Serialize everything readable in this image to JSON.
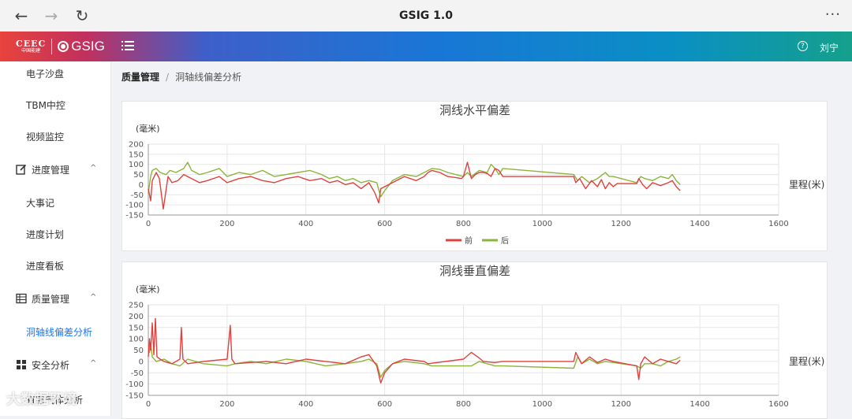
{
  "browser": {
    "back_glyph": "←",
    "forward_glyph": "→",
    "reload_glyph": "↻",
    "title": "GSIG 1.0",
    "more_glyph": "···"
  },
  "app": {
    "logo_top": "CEEC",
    "logo_bottom": "中国能建",
    "logo_text": "GSIG",
    "help_glyph": "?",
    "user": "刘宁",
    "accent": "#1677ff"
  },
  "sidebar": {
    "items": [
      {
        "label": "电子沙盘"
      },
      {
        "label": "TBM中控"
      },
      {
        "label": "视频监控"
      },
      {
        "label": "进度管理",
        "icon": "edit-icon",
        "chevron": "^"
      },
      {
        "label": "大事记"
      },
      {
        "label": "进度计划"
      },
      {
        "label": "进度看板"
      },
      {
        "label": "质量管理",
        "icon": "table-icon",
        "chevron": "^"
      },
      {
        "label": "洞轴线偏差分析"
      },
      {
        "label": "安全分析",
        "icon": "grid-icon",
        "chevron": "^"
      },
      {
        "label": "有害气体分析"
      }
    ]
  },
  "breadcrumb": {
    "first": "质量管理",
    "separator": "/",
    "second": "洞轴线偏差分析"
  },
  "watermark": "大数据环境",
  "chart_data": [
    {
      "type": "line",
      "title": "洞线水平偏差",
      "ylabel": "(毫米)",
      "xlabel": "里程(米)",
      "xlim": [
        0,
        1600
      ],
      "ylim": [
        -150,
        200
      ],
      "xticks": [
        "0",
        "200",
        "400",
        "600",
        "800",
        "1000",
        "1200",
        "1400",
        "1600"
      ],
      "yticks": [
        "200",
        "150",
        "100",
        "50",
        "0",
        "-50",
        "-100",
        "-150"
      ],
      "grid": true,
      "legend": "bottom",
      "series": [
        {
          "name": "前",
          "color": "#e0413e",
          "x": [
            0,
            6,
            10,
            20,
            28,
            38,
            50,
            60,
            75,
            90,
            110,
            130,
            150,
            180,
            200,
            230,
            260,
            290,
            320,
            350,
            380,
            410,
            440,
            460,
            480,
            500,
            520,
            540,
            560,
            575,
            585,
            590,
            600,
            620,
            650,
            680,
            700,
            710,
            720,
            740,
            760,
            780,
            795,
            800,
            810,
            820,
            830,
            840,
            850,
            860,
            870,
            880,
            890,
            900,
            1080,
            1085,
            1095,
            1110,
            1125,
            1140,
            1150,
            1160,
            1170,
            1180,
            1190,
            1240,
            1245,
            1255,
            1265,
            1280,
            1300,
            1320,
            1330,
            1340,
            1350
          ],
          "y": [
            -20,
            -80,
            20,
            60,
            30,
            -120,
            40,
            10,
            20,
            50,
            30,
            10,
            20,
            40,
            10,
            30,
            40,
            20,
            10,
            30,
            40,
            20,
            30,
            10,
            20,
            0,
            10,
            -20,
            10,
            -40,
            -90,
            -20,
            -10,
            10,
            40,
            20,
            40,
            60,
            70,
            60,
            40,
            35,
            30,
            40,
            110,
            30,
            50,
            60,
            60,
            55,
            40,
            80,
            70,
            40,
            40,
            10,
            30,
            -20,
            20,
            -10,
            25,
            -20,
            10,
            -10,
            5,
            5,
            30,
            0,
            -20,
            10,
            -5,
            10,
            20,
            -10,
            -30
          ]
        },
        {
          "name": "后",
          "color": "#8ab53a",
          "x": [
            0,
            6,
            10,
            20,
            30,
            45,
            55,
            70,
            90,
            100,
            110,
            130,
            150,
            180,
            200,
            230,
            260,
            290,
            320,
            350,
            380,
            410,
            440,
            460,
            480,
            500,
            520,
            540,
            560,
            580,
            590,
            600,
            620,
            650,
            680,
            700,
            720,
            740,
            760,
            780,
            800,
            810,
            820,
            840,
            860,
            870,
            880,
            890,
            900,
            1080,
            1090,
            1100,
            1120,
            1140,
            1160,
            1170,
            1180,
            1240,
            1250,
            1260,
            1280,
            1300,
            1320,
            1330,
            1340,
            1350
          ],
          "y": [
            -40,
            40,
            70,
            80,
            60,
            50,
            70,
            60,
            80,
            110,
            70,
            50,
            60,
            80,
            40,
            60,
            50,
            70,
            40,
            50,
            60,
            70,
            50,
            30,
            40,
            20,
            30,
            10,
            20,
            10,
            -60,
            -30,
            20,
            50,
            40,
            60,
            80,
            75,
            60,
            50,
            40,
            60,
            40,
            70,
            60,
            100,
            80,
            50,
            80,
            50,
            20,
            40,
            10,
            30,
            60,
            40,
            40,
            10,
            40,
            30,
            20,
            40,
            30,
            50,
            20,
            0
          ]
        }
      ]
    },
    {
      "type": "line",
      "title": "洞线垂直偏差",
      "ylabel": "(毫米)",
      "xlabel": "里程(米)",
      "xlim": [
        0,
        1600
      ],
      "ylim": [
        -150,
        250
      ],
      "xticks": [
        "0",
        "200",
        "400",
        "600",
        "800",
        "1000",
        "1200",
        "1400",
        "1600"
      ],
      "yticks": [
        "250",
        "200",
        "150",
        "100",
        "50",
        "0",
        "-50",
        "-100",
        "-150"
      ],
      "grid": true,
      "series": [
        {
          "name": "前",
          "color": "#e0413e",
          "x": [
            0,
            3,
            6,
            10,
            14,
            18,
            22,
            30,
            40,
            60,
            80,
            84,
            88,
            100,
            140,
            200,
            208,
            212,
            220,
            260,
            300,
            350,
            400,
            450,
            500,
            540,
            560,
            580,
            590,
            600,
            620,
            650,
            700,
            710,
            800,
            820,
            840,
            850,
            880,
            900,
            1080,
            1085,
            1100,
            1120,
            1140,
            1160,
            1180,
            1240,
            1245,
            1250,
            1260,
            1280,
            1300,
            1320,
            1340,
            1350
          ],
          "y": [
            20,
            100,
            50,
            170,
            30,
            190,
            20,
            10,
            0,
            -10,
            10,
            150,
            10,
            -10,
            0,
            10,
            160,
            10,
            -10,
            -5,
            0,
            -10,
            10,
            0,
            -10,
            20,
            30,
            -20,
            -95,
            -50,
            -10,
            10,
            0,
            -10,
            10,
            40,
            15,
            0,
            -5,
            0,
            0,
            40,
            -10,
            20,
            -5,
            10,
            0,
            -20,
            -80,
            -10,
            20,
            -10,
            10,
            0,
            -10,
            5
          ]
        },
        {
          "name": "后",
          "color": "#8ab53a",
          "x": [
            0,
            3,
            6,
            10,
            20,
            40,
            60,
            80,
            100,
            140,
            200,
            220,
            260,
            300,
            350,
            400,
            450,
            500,
            540,
            560,
            580,
            590,
            600,
            620,
            650,
            700,
            720,
            800,
            820,
            840,
            860,
            880,
            900,
            1080,
            1090,
            1100,
            1120,
            1140,
            1160,
            1180,
            1240,
            1250,
            1260,
            1280,
            1300,
            1320,
            1340,
            1350
          ],
          "y": [
            70,
            40,
            80,
            20,
            0,
            10,
            -10,
            -20,
            10,
            -10,
            -20,
            -10,
            0,
            -10,
            10,
            0,
            -20,
            -10,
            0,
            10,
            -10,
            -70,
            -40,
            -10,
            0,
            -10,
            -20,
            -20,
            -20,
            0,
            -10,
            -20,
            -20,
            -30,
            20,
            -10,
            10,
            -10,
            0,
            -5,
            -20,
            -30,
            -10,
            -10,
            -20,
            0,
            10,
            20
          ]
        }
      ]
    }
  ]
}
